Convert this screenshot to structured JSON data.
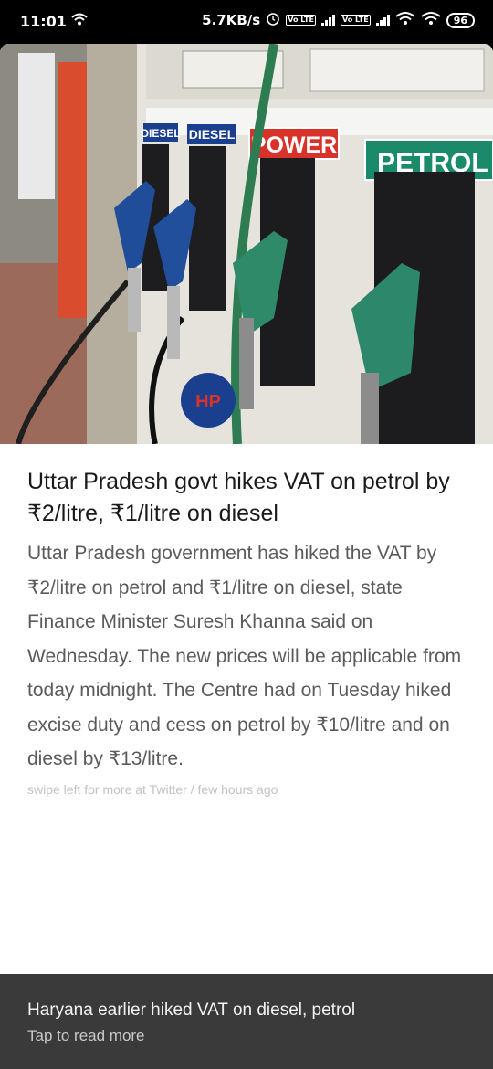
{
  "status_bar": {
    "time": "11:01",
    "network_speed": "5.7KB/s",
    "sim_badge": "Vo LTE",
    "battery": "96"
  },
  "article": {
    "image_alt": "Fuel dispensing nozzles at a petrol pump",
    "pump_labels": {
      "diesel_1": "DIESEL",
      "diesel_2": "DIESEL",
      "power": "POWER",
      "petrol": "PETROL"
    },
    "headline": "Uttar Pradesh govt hikes VAT on petrol by ₹2/litre, ₹1/litre on diesel",
    "summary": "Uttar Pradesh government has hiked the VAT by ₹2/litre on petrol and ₹1/litre on diesel, state Finance Minister Suresh Khanna said on Wednesday. The new prices will be applicable from today midnight. The Centre had on Tuesday hiked excise duty and cess on petrol by ₹10/litre and on diesel by ₹13/litre.",
    "meta": "swipe left for more at Twitter / few hours ago"
  },
  "footer": {
    "title": "Haryana earlier hiked VAT on diesel, petrol",
    "subtitle": "Tap to read more"
  },
  "colors": {
    "headline": "#1a1a1a",
    "summary": "#5b5b5b",
    "meta": "#c3c3c3",
    "footer_bg": "#3a3a3a",
    "power_red": "#d8322a",
    "petrol_green": "#1a8a6a",
    "diesel_blue": "#1b3f8f",
    "nozzle_green": "#2f8a6a"
  }
}
